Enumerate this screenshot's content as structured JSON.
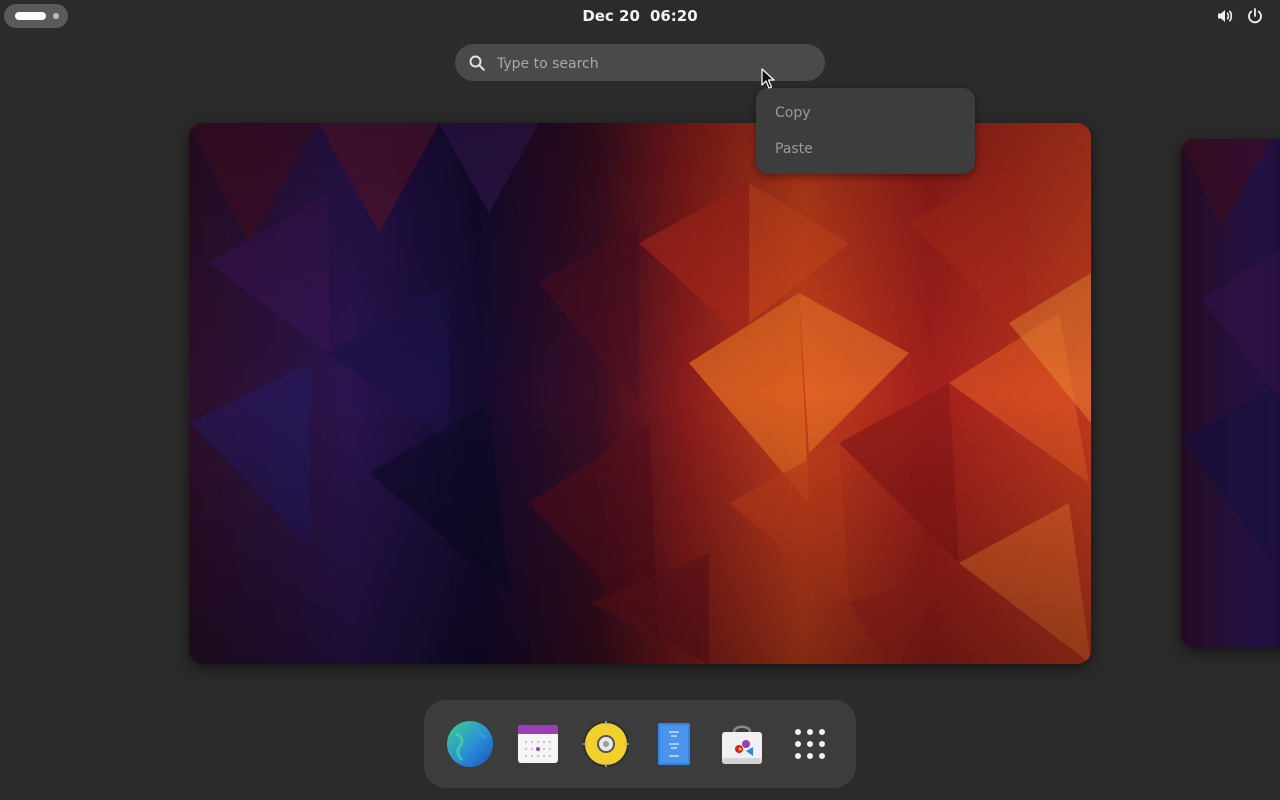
{
  "topbar": {
    "activities": "activities-indicator",
    "clock": {
      "date": "Dec 20",
      "time": "06:20"
    },
    "tray": {
      "volume_icon": "speaker-icon",
      "power_icon": "power-icon"
    }
  },
  "search": {
    "placeholder": "Type to search",
    "value": "",
    "icon": "search-icon"
  },
  "context_menu": {
    "items": [
      {
        "label": "Copy"
      },
      {
        "label": "Paste"
      }
    ]
  },
  "dash": {
    "apps": [
      {
        "icon": "web-browser-icon"
      },
      {
        "icon": "calendar-icon"
      },
      {
        "icon": "music-player-icon"
      },
      {
        "icon": "text-editor-icon"
      },
      {
        "icon": "software-store-icon"
      },
      {
        "icon": "show-apps-grid-icon"
      }
    ]
  },
  "colors": {
    "background": "#2b2b2b",
    "panel": "#3c3c3c",
    "search": "#4a4a4a",
    "menu": "#3d3d3d",
    "wallpaper_dark": "#1a1236",
    "wallpaper_warm": "#e2561f"
  }
}
